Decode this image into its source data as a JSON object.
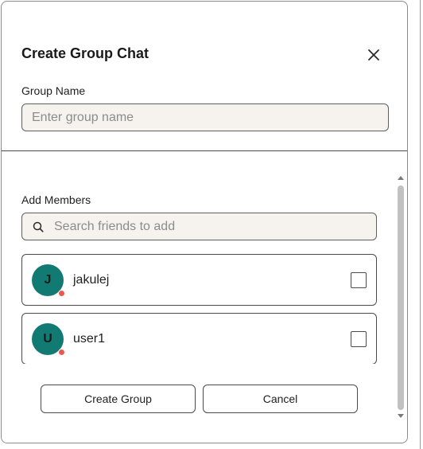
{
  "dialog": {
    "title": "Create Group Chat",
    "close_icon": "close-icon"
  },
  "group_name": {
    "label": "Group Name",
    "value": "",
    "placeholder": "Enter group name"
  },
  "members": {
    "label": "Add Members",
    "search": {
      "icon": "search-icon",
      "value": "",
      "placeholder": "Search friends to add"
    },
    "list": [
      {
        "initial": "J",
        "name": "jakulej",
        "status": "offline",
        "checked": false
      },
      {
        "initial": "U",
        "name": "user1",
        "status": "offline",
        "checked": false
      }
    ]
  },
  "actions": {
    "create_label": "Create Group",
    "cancel_label": "Cancel"
  },
  "colors": {
    "avatar_bg": "#117a73",
    "status_dot": "#e85a4f",
    "input_bg": "#f6f3ef"
  }
}
